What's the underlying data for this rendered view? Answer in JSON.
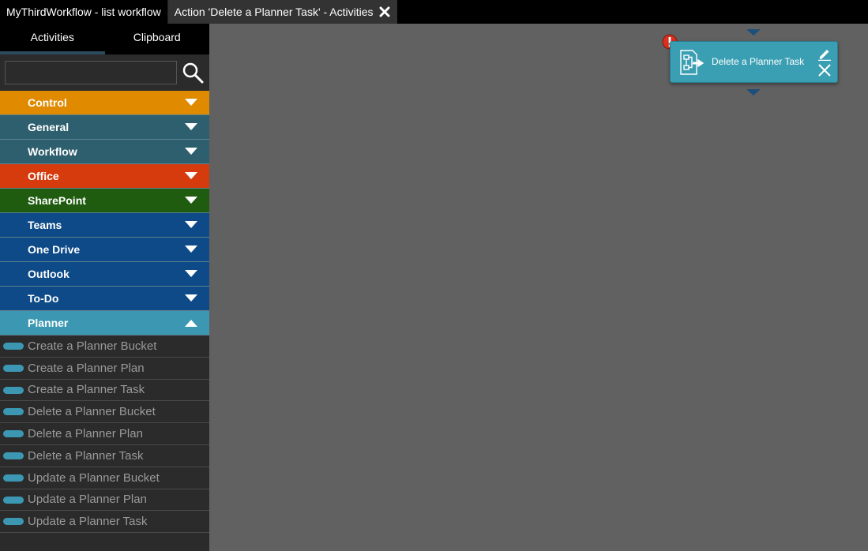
{
  "tabs": [
    {
      "label": "MyThirdWorkflow - list workflow"
    },
    {
      "label": "Action 'Delete a Planner Task' - Activities"
    }
  ],
  "sidebar": {
    "tabs": [
      {
        "label": "Activities"
      },
      {
        "label": "Clipboard"
      }
    ],
    "search": {
      "value": "",
      "placeholder": ""
    },
    "categories": [
      {
        "label": "Control",
        "color": "#e08a00",
        "expanded": false
      },
      {
        "label": "General",
        "color": "#2e5f6e",
        "expanded": false
      },
      {
        "label": "Workflow",
        "color": "#2e5f6e",
        "expanded": false
      },
      {
        "label": "Office",
        "color": "#d63b0d",
        "expanded": false
      },
      {
        "label": "SharePoint",
        "color": "#1f5c10",
        "expanded": false
      },
      {
        "label": "Teams",
        "color": "#0d4a87",
        "expanded": false
      },
      {
        "label": "One Drive",
        "color": "#0d4a87",
        "expanded": false
      },
      {
        "label": "Outlook",
        "color": "#0d4a87",
        "expanded": false
      },
      {
        "label": "To-Do",
        "color": "#0d4a87",
        "expanded": false
      },
      {
        "label": "Planner",
        "color": "#3b97b2",
        "expanded": true
      }
    ],
    "planner_activities": [
      "Create a Planner Bucket",
      "Create a Planner Plan",
      "Create a Planner Task",
      "Delete a Planner Bucket",
      "Delete a Planner Plan",
      "Delete a Planner Task",
      "Update a Planner Bucket",
      "Update a Planner Plan",
      "Update a Planner Task"
    ]
  },
  "canvas": {
    "node": {
      "label": "Delete a Planner Task",
      "icon": "workflow-action-icon",
      "color": "#3b9fb3"
    },
    "warning_color": "#d9301f",
    "connector_color": "#1e4f78"
  }
}
